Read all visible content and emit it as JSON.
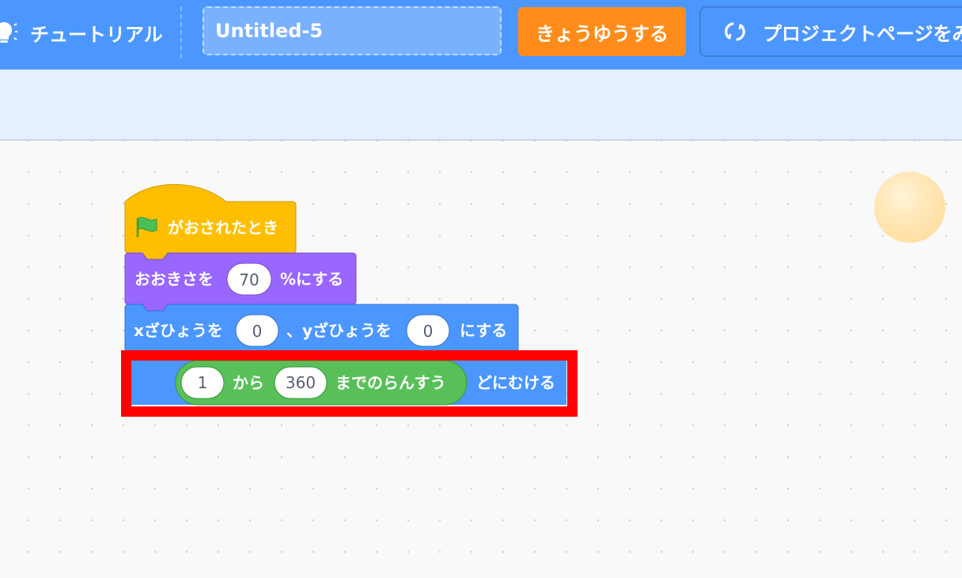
{
  "menu": {
    "tutorial_label": "チュートリアル",
    "project_title": "Untitled-5",
    "share_label": "きょうゆうする",
    "project_page_label": "プロジェクトページをみる"
  },
  "blocks": {
    "hat": {
      "label": "がおされたとき",
      "color": "#ffbf00"
    },
    "set_size": {
      "before": "おおきさを",
      "value": "70",
      "after": "%にする",
      "color": "#9966ff"
    },
    "go_to_xy": {
      "before": "xざひょうを",
      "x": "0",
      "middle": "、yざひょうを",
      "y": "0",
      "after": "にする",
      "color": "#4c97ff"
    },
    "point_in_direction": {
      "after": "どにむける",
      "color": "#4c97ff",
      "random": {
        "from": "1",
        "word": "から",
        "to": "360",
        "suffix": "までのらんすう",
        "color": "#59c059"
      }
    }
  },
  "icons": {
    "tutorial": "lightbulb-icon",
    "remix": "remix-icon",
    "flag": "green-flag-icon"
  },
  "highlight_color": "#ff0000"
}
